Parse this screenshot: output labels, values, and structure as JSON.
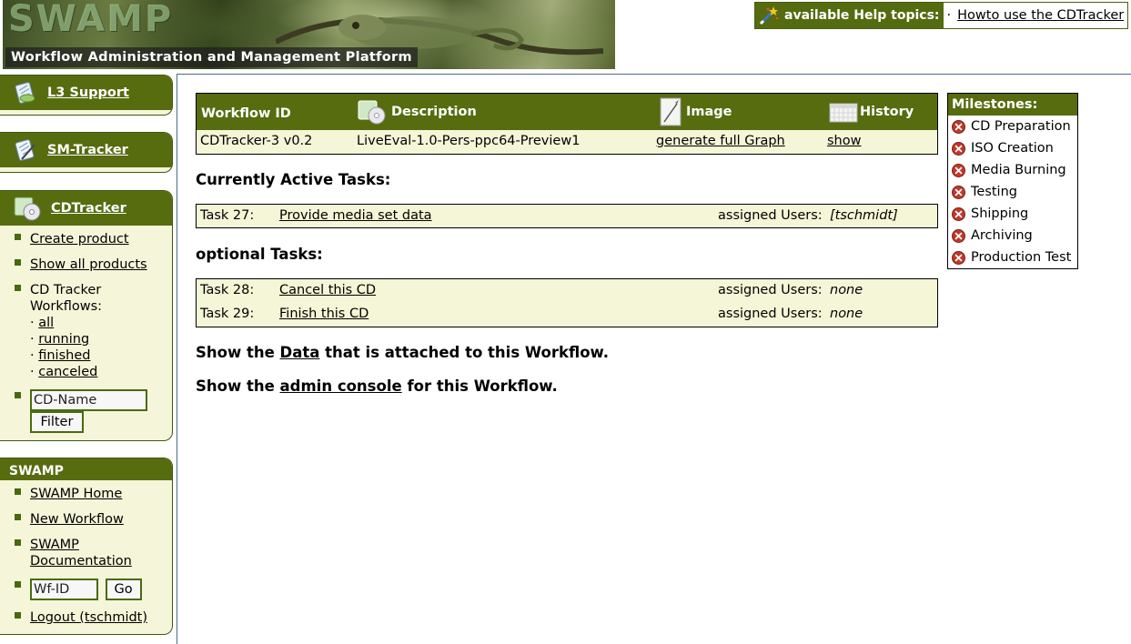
{
  "banner": {
    "logo": "SWAMP",
    "platform": "Workflow Administration and Management Platform"
  },
  "help": {
    "label": "available Help topics:",
    "separator": "·",
    "topic": "Howto use the CDTracker"
  },
  "sidebar": {
    "l3": {
      "title": "L3 Support"
    },
    "sm": {
      "title": "SM-Tracker"
    },
    "cd": {
      "title": "CDTracker",
      "create": "Create product",
      "show_all": "Show all products",
      "workflows_label": "CD Tracker Workflows:",
      "bullet": "·",
      "filters": [
        "all",
        "running",
        "finished",
        "canceled"
      ],
      "name_placeholder": "CD-Name",
      "filter_button": "Filter"
    },
    "swamp": {
      "title": "SWAMP",
      "home": "SWAMP Home",
      "new_workflow": "New Workflow",
      "documentation": "SWAMP Documentation",
      "wf_placeholder": "Wf-ID",
      "go_button": "Go",
      "logout": "Logout (tschmidt)"
    }
  },
  "workflow": {
    "headers": {
      "id": "Workflow ID",
      "description": "Description",
      "image": "Image",
      "history": "History"
    },
    "row": {
      "id": "CDTracker-3 v0.2",
      "description": "LiveEval-1.0-Pers-ppc64-Preview1",
      "image_link": "generate full Graph",
      "history_link": "show"
    }
  },
  "active": {
    "title": "Currently Active Tasks:",
    "tasks": [
      {
        "id": "Task 27:",
        "name": "Provide media set data",
        "assigned_label": "assigned Users:",
        "users": "[tschmidt]"
      }
    ]
  },
  "optional": {
    "title": "optional Tasks:",
    "tasks": [
      {
        "id": "Task 28:",
        "name": "Cancel this CD",
        "assigned_label": "assigned Users:",
        "users": "none"
      },
      {
        "id": "Task 29:",
        "name": "Finish this CD",
        "assigned_label": "assigned Users:",
        "users": "none"
      }
    ]
  },
  "data_line": {
    "pre": "Show the",
    "link": "Data",
    "post": "that is attached to this Workflow."
  },
  "admin_line": {
    "pre": "Show the",
    "link": "admin console",
    "post": "for this Workflow."
  },
  "milestones": {
    "title": "Milestones:",
    "items": [
      "CD Preparation",
      "ISO Creation",
      "Media Burning",
      "Testing",
      "Shipping",
      "Archiving",
      "Production Test"
    ]
  },
  "colors": {
    "header_green": "#566c0f",
    "panel_bg": "#f5f5d7",
    "bullet_green": "#476a0a",
    "milestone_red": "#c0392b"
  }
}
